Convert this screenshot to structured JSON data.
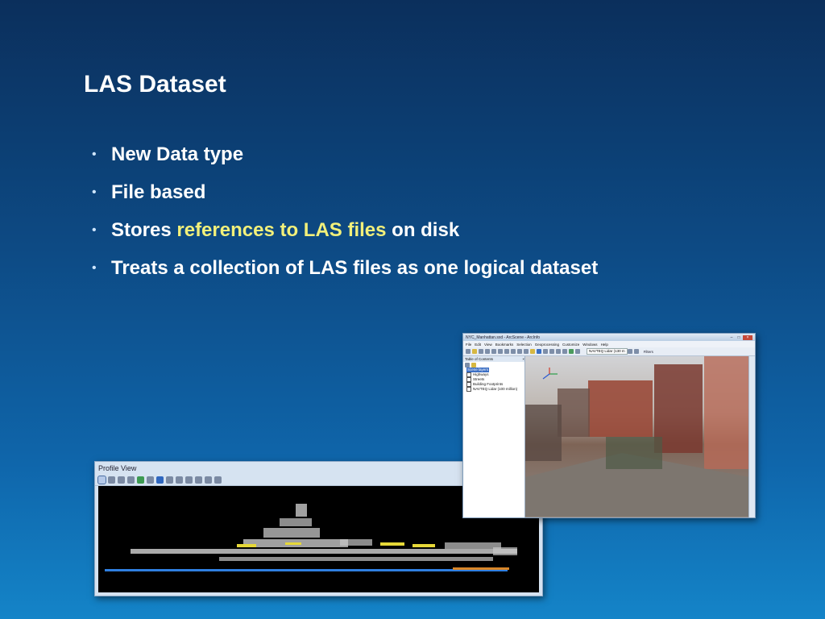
{
  "slide": {
    "title": "LAS Dataset",
    "bullets": [
      {
        "text": "New Data type"
      },
      {
        "text": "File based"
      },
      {
        "pre": "Stores ",
        "highlight": "references to LAS files",
        "post": " on disk"
      },
      {
        "text": "Treats a collection of LAS files as one logical dataset"
      }
    ],
    "colors": {
      "highlight": "#f2f07a",
      "text": "#ffffff"
    }
  },
  "arcscene": {
    "window_title": "NYC_Manhattan.sxd - ArcScene - ArcInfo",
    "menu": [
      "File",
      "Edit",
      "View",
      "Bookmarks",
      "Selection",
      "Geoprocessing",
      "Customize",
      "Windows",
      "Help"
    ],
    "layer_dropdown": "NAVTEQ Lidar (130 m",
    "filters_label": "Filters",
    "toc_title": "Table of Contents",
    "toc_items": [
      "Scene layers",
      "Highways",
      "Streets",
      "Building Footprints",
      "NAVTEQ Lidar (100 million)"
    ]
  },
  "profile_view": {
    "title": "Profile View"
  }
}
